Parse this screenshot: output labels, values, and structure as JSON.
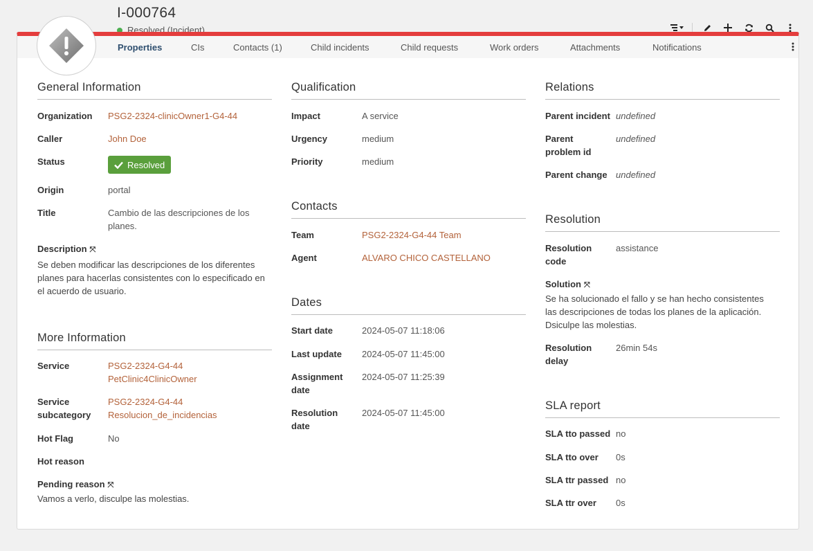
{
  "header": {
    "ref": "I-000764",
    "state_label": "Resolved (Incident)",
    "status_color": "#4caf50",
    "accent_color": "#e43d3d",
    "toolbar_icons": [
      "list-actions-icon",
      "edit-icon",
      "add-icon",
      "refresh-icon",
      "search-icon",
      "more-icon"
    ]
  },
  "tabs": [
    "Properties",
    "CIs",
    "Contacts (1)",
    "Child incidents",
    "Child requests",
    "Work orders",
    "Attachments",
    "Notifications"
  ],
  "general": {
    "title": "General Information",
    "organization_label": "Organization",
    "organization_value": "PSG2-2324-clinicOwner1-G4-44",
    "caller_label": "Caller",
    "caller_value": "John Doe",
    "status_label": "Status",
    "status_value": "Resolved",
    "origin_label": "Origin",
    "origin_value": "portal",
    "title_label": "Title",
    "title_line1": "Cambio de las descripciones de los",
    "title_line2": "planes.",
    "description_label": "Description",
    "description_line1": "Se deben modificar las descripciones de los diferentes",
    "description_line2": "planes para hacerlas consistentes con lo especificado en",
    "description_line3": "el acuerdo de usuario."
  },
  "more": {
    "title": "More Information",
    "service_label": "Service",
    "service_line1": "PSG2-2324-G4-44",
    "service_line2": "PetClinic4ClinicOwner",
    "subcat_label_1": "Service",
    "subcat_label_2": "subcategory",
    "subcat_line1": "PSG2-2324-G4-44",
    "subcat_line2": "Resolucion_de_incidencias",
    "hotflag_label": "Hot Flag",
    "hotflag_value": "No",
    "hotreason_label": "Hot reason",
    "pending_label": "Pending reason",
    "pending_value": "Vamos a verlo, disculpe las molestias."
  },
  "qualification": {
    "title": "Qualification",
    "impact_label": "Impact",
    "impact_value": "A service",
    "urgency_label": "Urgency",
    "urgency_value": "medium",
    "priority_label": "Priority",
    "priority_value": "medium"
  },
  "contacts": {
    "title": "Contacts",
    "team_label": "Team",
    "team_value": "PSG2-2324-G4-44 Team",
    "agent_label": "Agent",
    "agent_value": "ALVARO CHICO CASTELLANO"
  },
  "dates": {
    "title": "Dates",
    "start_label": "Start date",
    "start_value": "2024-05-07 11:18:06",
    "update_label": "Last update",
    "update_value": "2024-05-07 11:45:00",
    "assign_label_1": "Assignment",
    "assign_label_2": "date",
    "assign_value": "2024-05-07 11:25:39",
    "resolution_label_1": "Resolution",
    "resolution_label_2": "date",
    "resolution_value": "2024-05-07 11:45:00"
  },
  "relations": {
    "title": "Relations",
    "parent_incident_label": "Parent incident",
    "parent_incident_value": "undefined",
    "parent_problem_label_1": "Parent",
    "parent_problem_label_2": "problem id",
    "parent_problem_value": "undefined",
    "parent_change_label": "Parent change",
    "parent_change_value": "undefined"
  },
  "resolution": {
    "title": "Resolution",
    "code_label_1": "Resolution",
    "code_label_2": "code",
    "code_value": "assistance",
    "solution_label": "Solution",
    "solution_line1": "Se ha solucionado el fallo y se han hecho consistentes",
    "solution_line2": "las descripciones de todas los planes de la aplicación.",
    "solution_line3": "Dsiculpe las molestias.",
    "delay_label_1": "Resolution",
    "delay_label_2": "delay",
    "delay_value": "26min 54s"
  },
  "sla": {
    "title": "SLA report",
    "tto_passed_label": "SLA tto passed",
    "tto_passed_value": "no",
    "tto_over_label": "SLA tto over",
    "tto_over_value": "0s",
    "ttr_passed_label": "SLA ttr passed",
    "ttr_passed_value": "no",
    "ttr_over_label": "SLA ttr over",
    "ttr_over_value": "0s"
  }
}
